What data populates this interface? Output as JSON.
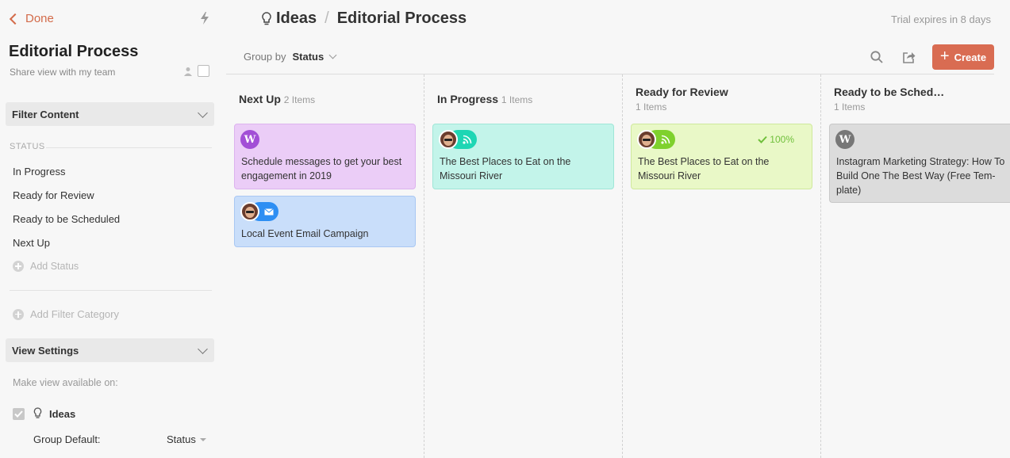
{
  "sidebar": {
    "done_label": "Done",
    "title": "Editorial Process",
    "share_label": "Share view with my team",
    "filter_content": "Filter Content",
    "status_heading": "STATUS",
    "statuses": [
      "In Progress",
      "Ready for Review",
      "Ready to be Scheduled",
      "Next Up"
    ],
    "add_status": "Add Status",
    "add_filter_category": "Add Filter Category",
    "view_settings": "View Settings",
    "make_available": "Make view available on:",
    "ideas_label": "Ideas",
    "group_default_label": "Group Default:",
    "group_default_value": "Status"
  },
  "header": {
    "breadcrumb_root": "Ideas",
    "breadcrumb_sep": "/",
    "breadcrumb_current": "Editorial Process",
    "trial": "Trial expires in 8 days",
    "group_by_label": "Group by",
    "group_by_value": "Status",
    "create_label": "Create"
  },
  "columns": [
    {
      "title": "Next Up",
      "count": "2 Items",
      "cards": [
        {
          "text": "Schedule messages to get your best engagement in 2019",
          "type": "wordpress"
        },
        {
          "text": "Local Event Email Campaign",
          "type": "email"
        }
      ]
    },
    {
      "title": "In Progress",
      "count": "1 Items",
      "cards": [
        {
          "text": "The Best Places to Eat on the Missouri River",
          "type": "rss"
        }
      ]
    },
    {
      "title": "Ready for Review",
      "count": "1 Items",
      "cards": [
        {
          "text": "The Best Places to Eat on the Missouri River",
          "type": "rss",
          "progress": "100%"
        }
      ]
    },
    {
      "title": "Ready to be Sched…",
      "count": "1 Items",
      "cards": [
        {
          "text": "Instagram Marketing Strategy: How To Build One The Best Way (Free Tem-plate)",
          "type": "wordpress"
        }
      ]
    }
  ],
  "colors": {
    "accent": "#d96c52",
    "card_purple": "#ebcdf7",
    "card_blue": "#c9defa",
    "card_teal": "#c3f4ea",
    "card_green": "#e9f8c7",
    "card_gray": "#dcdcdc"
  }
}
